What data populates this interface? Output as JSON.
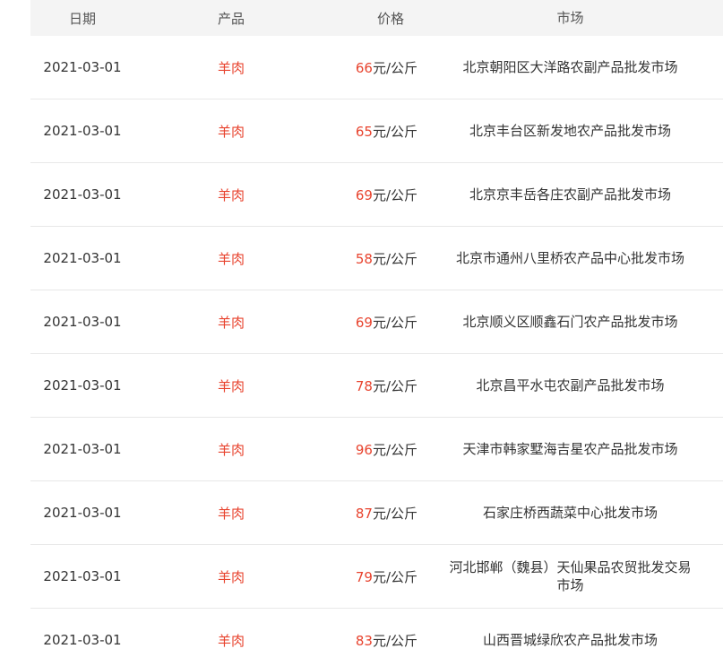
{
  "table": {
    "headers": [
      "日期",
      "产品",
      "价格",
      "市场"
    ],
    "rows": [
      {
        "date": "2021-03-01",
        "product": "羊肉",
        "price": "66",
        "unit": "元/公斤",
        "market": "北京朝阳区大洋路农副产品批发市场"
      },
      {
        "date": "2021-03-01",
        "product": "羊肉",
        "price": "65",
        "unit": "元/公斤",
        "market": "北京丰台区新发地农产品批发市场"
      },
      {
        "date": "2021-03-01",
        "product": "羊肉",
        "price": "69",
        "unit": "元/公斤",
        "market": "北京京丰岳各庄农副产品批发市场"
      },
      {
        "date": "2021-03-01",
        "product": "羊肉",
        "price": "58",
        "unit": "元/公斤",
        "market": "北京市通州八里桥农产品中心批发市场"
      },
      {
        "date": "2021-03-01",
        "product": "羊肉",
        "price": "69",
        "unit": "元/公斤",
        "market": "北京顺义区顺鑫石门农产品批发市场"
      },
      {
        "date": "2021-03-01",
        "product": "羊肉",
        "price": "78",
        "unit": "元/公斤",
        "market": "北京昌平水屯农副产品批发市场"
      },
      {
        "date": "2021-03-01",
        "product": "羊肉",
        "price": "96",
        "unit": "元/公斤",
        "market": "天津市韩家墅海吉星农产品批发市场"
      },
      {
        "date": "2021-03-01",
        "product": "羊肉",
        "price": "87",
        "unit": "元/公斤",
        "market": "石家庄桥西蔬菜中心批发市场"
      },
      {
        "date": "2021-03-01",
        "product": "羊肉",
        "price": "79",
        "unit": "元/公斤",
        "market": "河北邯郸（魏县）天仙果品农贸批发交易市场"
      },
      {
        "date": "2021-03-01",
        "product": "羊肉",
        "price": "83",
        "unit": "元/公斤",
        "market": "山西晋城绿欣农产品批发市场"
      }
    ]
  },
  "colors": {
    "accent": "#e8442f",
    "header_bg": "#f4f4f4",
    "text": "#333333",
    "divider": "#e8e8e8"
  }
}
